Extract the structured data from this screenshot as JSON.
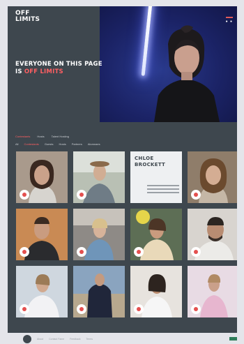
{
  "brand": {
    "line1": "OFF",
    "line2": "LIMITS"
  },
  "headline": {
    "prefix": "EVERYONE ON THIS PAGE",
    "is_word": "IS ",
    "accent": "OFF LIMITS"
  },
  "colors": {
    "panel": "#3e474e",
    "accent": "#ff5f62",
    "hero": "#1b2366"
  },
  "tabs": [
    {
      "label": "Contestants",
      "active": true
    },
    {
      "label": "Hosts",
      "active": false
    },
    {
      "label": "Talent Hosting",
      "active": false
    }
  ],
  "filters": [
    {
      "label": "All",
      "active": false
    },
    {
      "label": "Contestants",
      "active": true
    },
    {
      "label": "Guests",
      "active": false
    },
    {
      "label": "Hosts",
      "active": false
    },
    {
      "label": "Partners",
      "active": false
    },
    {
      "label": "Alumnaes",
      "active": false
    }
  ],
  "featured_card": {
    "name": "CHLOE BROCKETT"
  },
  "footer": {
    "links": [
      "About",
      "Contact Fame",
      "Feedback",
      "Terms"
    ]
  },
  "icons": {
    "badge": "record-badge-icon",
    "menu": "menu-icon"
  }
}
